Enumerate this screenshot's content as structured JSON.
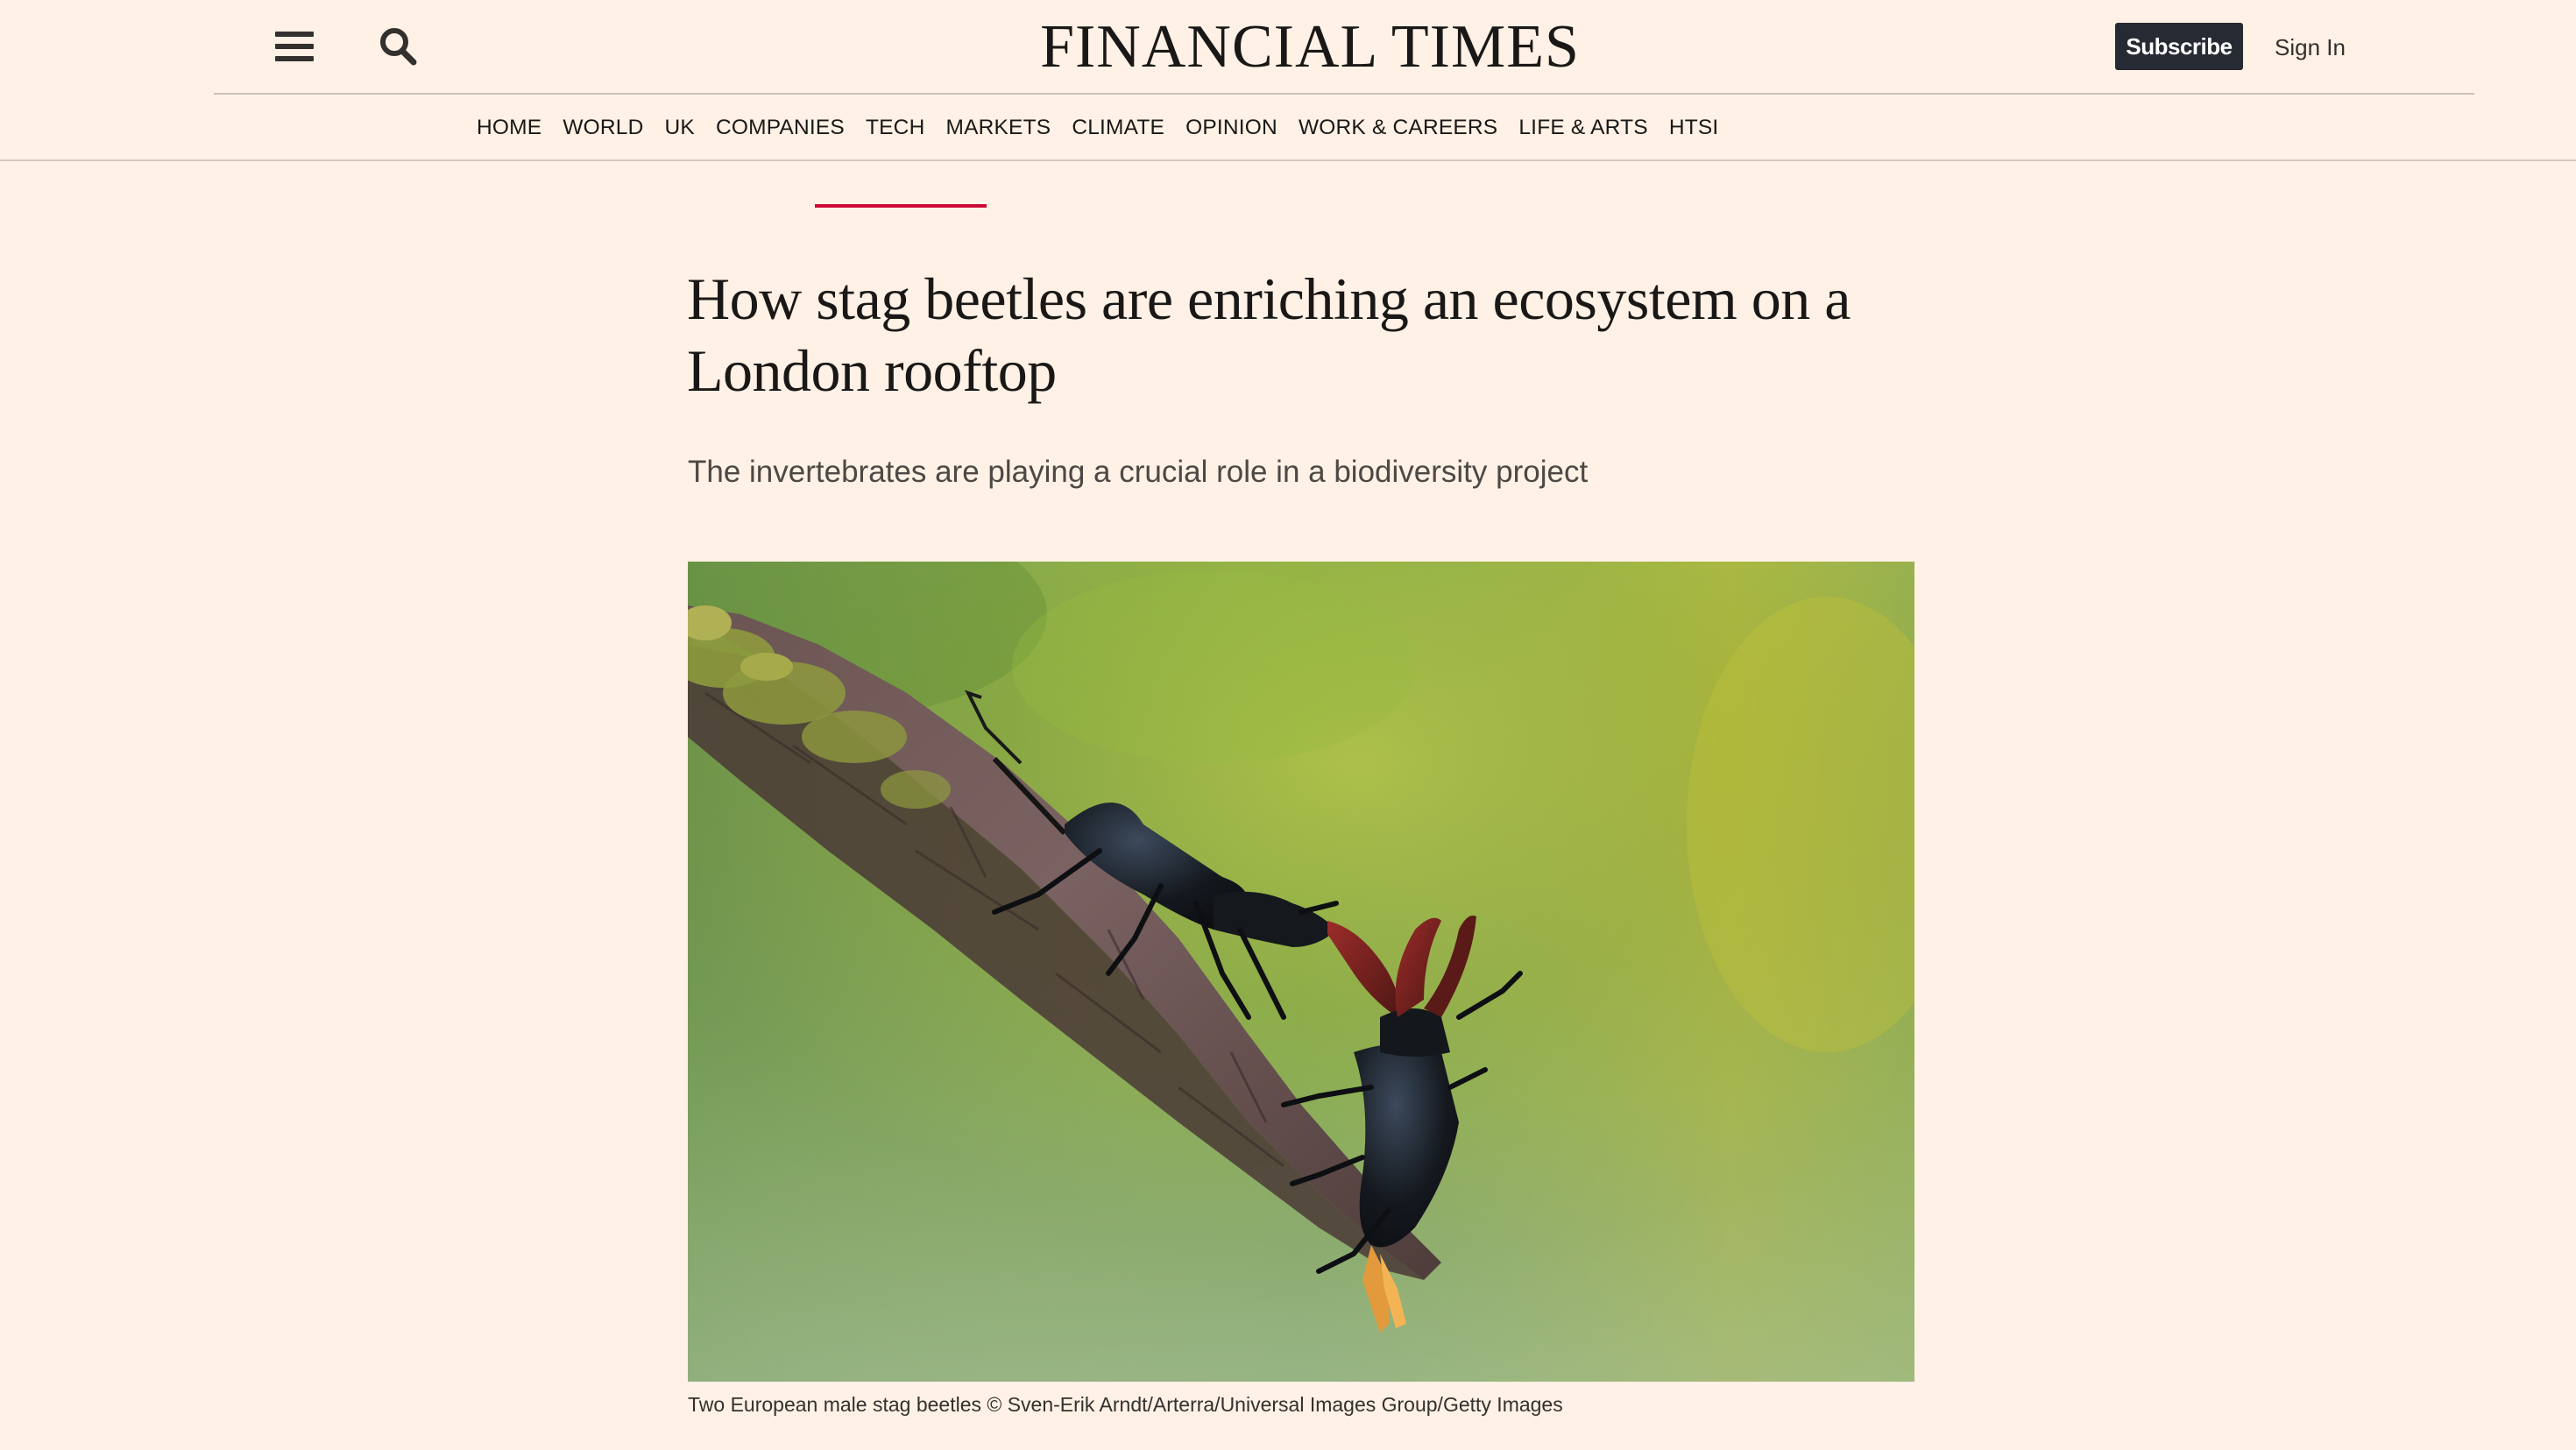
{
  "header": {
    "menu_icon": "hamburger-menu-icon",
    "search_icon": "search-icon",
    "logo_text": "FINANCIAL TIMES",
    "subscribe_label": "Subscribe",
    "signin_label": "Sign In"
  },
  "nav": {
    "items": [
      {
        "label": "HOME"
      },
      {
        "label": "WORLD"
      },
      {
        "label": "UK"
      },
      {
        "label": "COMPANIES"
      },
      {
        "label": "TECH"
      },
      {
        "label": "MARKETS"
      },
      {
        "label": "CLIMATE"
      },
      {
        "label": "OPINION"
      },
      {
        "label": "WORK & CAREERS"
      },
      {
        "label": "LIFE & ARTS"
      },
      {
        "label": "HTSI"
      }
    ]
  },
  "article": {
    "headline": "How stag beetles are enriching an ecosystem on a London rooftop",
    "standfirst": "The invertebrates are playing a crucial role in a biodiversity project",
    "image_caption": "Two European male stag beetles © Sven-Erik Arndt/Arterra/Universal Images Group/Getty Images"
  },
  "colors": {
    "background": "#fff1e5",
    "accent": "#cc0a37",
    "subscribe_bg": "#262a33"
  }
}
